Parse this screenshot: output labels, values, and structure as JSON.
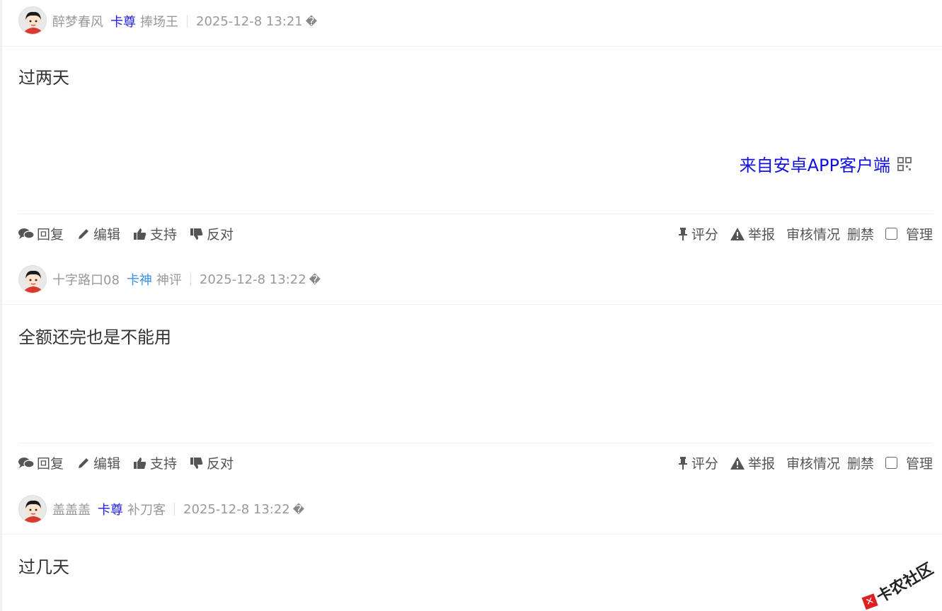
{
  "posts": [
    {
      "username": "醉梦春风",
      "badge": "卡尊",
      "rank": "捧场王",
      "time": "2025-12-8 13:21",
      "time_icon": "�",
      "content": "过两天",
      "device": "来自安卓APP客户端"
    },
    {
      "username": "十字路口08",
      "badge": "卡神",
      "rank": "神评",
      "time": "2025-12-8 13:22",
      "time_icon": "�",
      "content": "全额还完也是不能用"
    },
    {
      "username": "盖盖盖",
      "badge": "卡尊",
      "rank": "补刀客",
      "time": "2025-12-8 13:22",
      "time_icon": "�",
      "content": "过几天"
    }
  ],
  "actions": {
    "reply": "回复",
    "edit": "编辑",
    "support": "支持",
    "oppose": "反对",
    "rate": "评分",
    "report": "举报",
    "review": "审核情况",
    "ban": "删禁",
    "manage": "管理"
  },
  "watermark": "卡农社区",
  "colors": {
    "badge_zun": "#1f1fd6",
    "badge_shen": "#3b8fe8",
    "device_link": "#1010e0",
    "meta_gray": "#999999",
    "action_gray": "#555555"
  }
}
